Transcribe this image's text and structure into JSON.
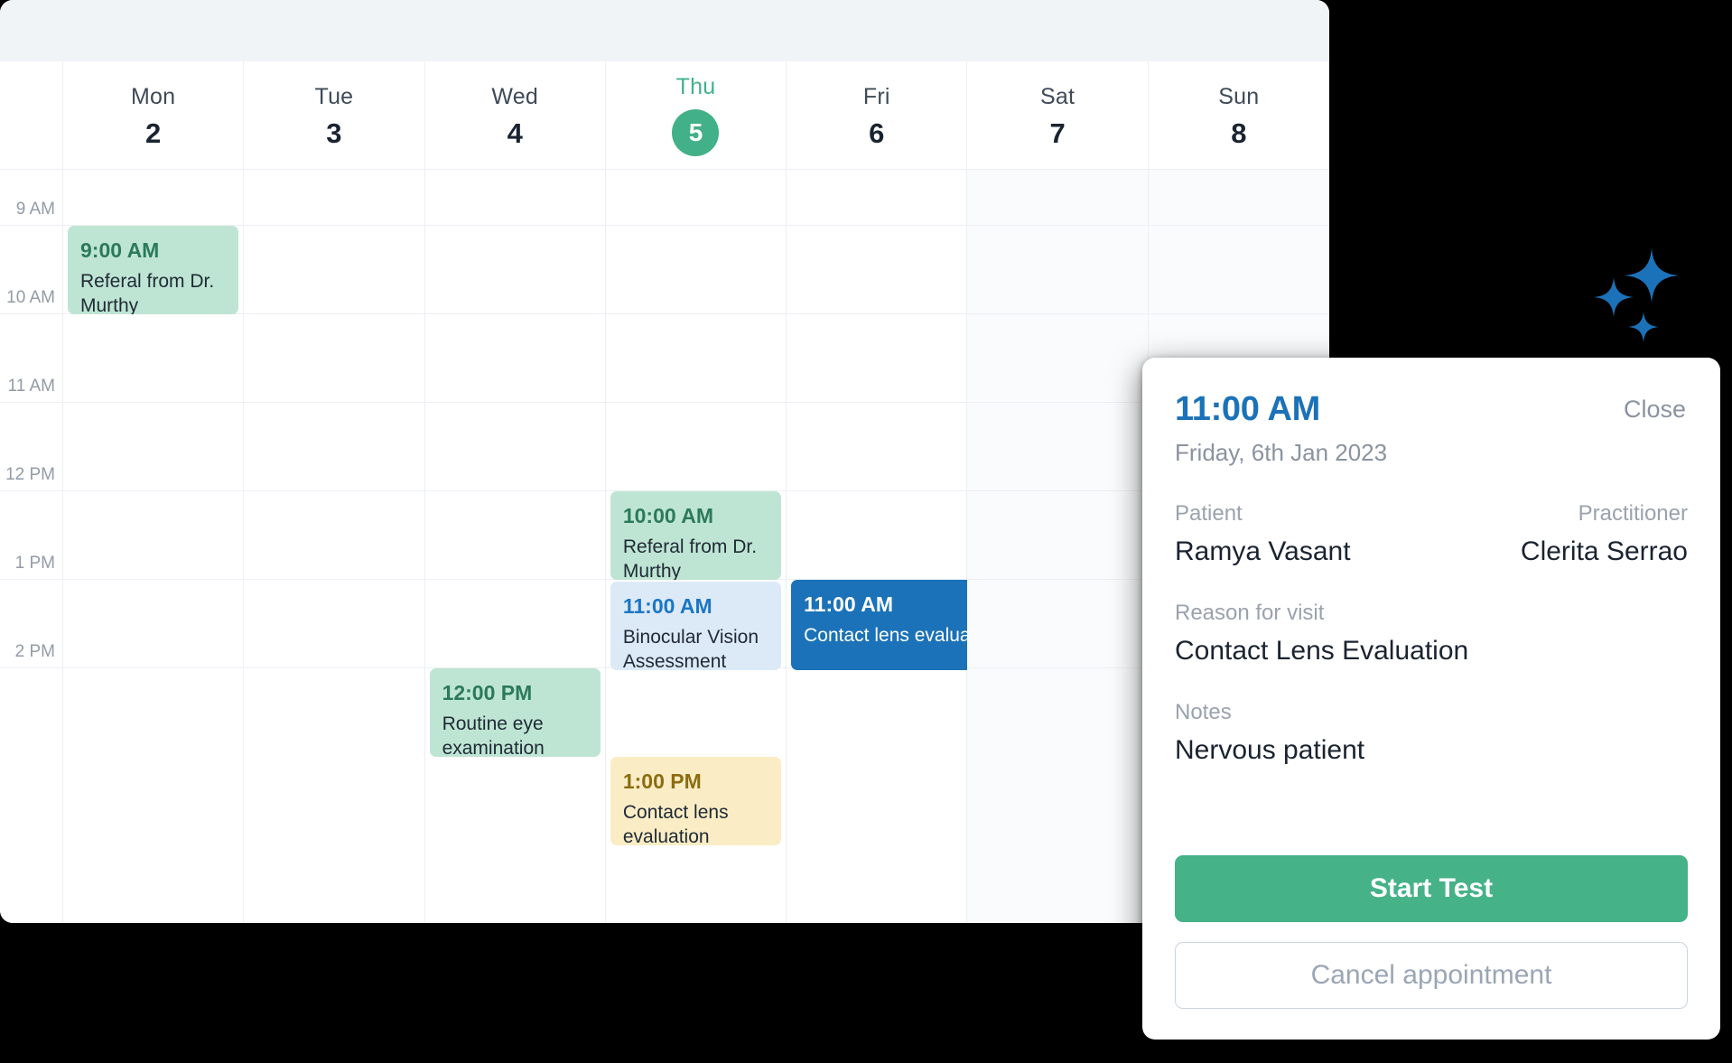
{
  "colors": {
    "accent_green": "#42B088",
    "accent_blue": "#1B72B8",
    "event_green_bg": "#BEE5D3",
    "event_lightblue_bg": "#DCEAF8",
    "event_yellow_bg": "#FAEDC5",
    "panel_bg": "#FFFFFF",
    "toolbar_bg": "#F1F4F7",
    "weekend_bg": "#FAFBFC"
  },
  "calendar": {
    "days": [
      {
        "name": "Mon",
        "date": "2",
        "today": false,
        "weekend": false
      },
      {
        "name": "Tue",
        "date": "3",
        "today": false,
        "weekend": false
      },
      {
        "name": "Wed",
        "date": "4",
        "today": false,
        "weekend": false
      },
      {
        "name": "Thu",
        "date": "5",
        "today": true,
        "weekend": false
      },
      {
        "name": "Fri",
        "date": "6",
        "today": false,
        "weekend": false
      },
      {
        "name": "Sat",
        "date": "7",
        "today": false,
        "weekend": true
      },
      {
        "name": "Sun",
        "date": "8",
        "today": false,
        "weekend": true
      }
    ],
    "hours": [
      "9 AM",
      "10 AM",
      "11 AM",
      "12 PM",
      "1 PM",
      "2 PM"
    ],
    "events": [
      {
        "day": "Mon",
        "time": "9:00 AM",
        "title": "Referal from Dr. Murthy",
        "color": "green"
      },
      {
        "day": "Wed",
        "time": "12:00 PM",
        "title": "Routine eye examination",
        "color": "green"
      },
      {
        "day": "Thu",
        "time": "10:00 AM",
        "title": "Referal from Dr. Murthy",
        "color": "green"
      },
      {
        "day": "Thu",
        "time": "11:00 AM",
        "title": "Binocular Vision Assessment",
        "color": "lightblue"
      },
      {
        "day": "Thu",
        "time": "1:00 PM",
        "title": "Contact lens evaluation",
        "color": "yellow"
      },
      {
        "day": "Fri",
        "time": "11:00 AM",
        "title": "Contact lens evaluation",
        "color": "solidblue"
      }
    ]
  },
  "detail_panel": {
    "time": "11:00 AM",
    "close_label": "Close",
    "date": "Friday, 6th Jan 2023",
    "patient_label": "Patient",
    "patient_name": "Ramya Vasant",
    "practitioner_label": "Practitioner",
    "practitioner_name": "Clerita Serrao",
    "reason_label": "Reason for visit",
    "reason_value": "Contact Lens Evaluation",
    "notes_label": "Notes",
    "notes_value": "Nervous patient",
    "primary_button": "Start Test",
    "secondary_button": "Cancel appointment"
  }
}
